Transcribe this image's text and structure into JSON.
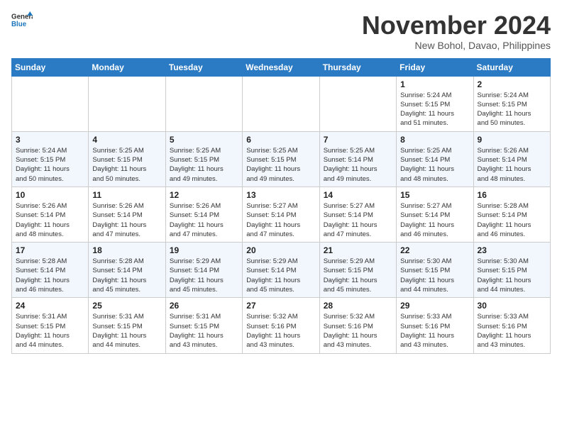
{
  "header": {
    "logo_line1": "General",
    "logo_line2": "Blue",
    "month_year": "November 2024",
    "location": "New Bohol, Davao, Philippines"
  },
  "columns": [
    "Sunday",
    "Monday",
    "Tuesday",
    "Wednesday",
    "Thursday",
    "Friday",
    "Saturday"
  ],
  "weeks": [
    [
      {
        "day": "",
        "info": ""
      },
      {
        "day": "",
        "info": ""
      },
      {
        "day": "",
        "info": ""
      },
      {
        "day": "",
        "info": ""
      },
      {
        "day": "",
        "info": ""
      },
      {
        "day": "1",
        "info": "Sunrise: 5:24 AM\nSunset: 5:15 PM\nDaylight: 11 hours\nand 51 minutes."
      },
      {
        "day": "2",
        "info": "Sunrise: 5:24 AM\nSunset: 5:15 PM\nDaylight: 11 hours\nand 50 minutes."
      }
    ],
    [
      {
        "day": "3",
        "info": "Sunrise: 5:24 AM\nSunset: 5:15 PM\nDaylight: 11 hours\nand 50 minutes."
      },
      {
        "day": "4",
        "info": "Sunrise: 5:25 AM\nSunset: 5:15 PM\nDaylight: 11 hours\nand 50 minutes."
      },
      {
        "day": "5",
        "info": "Sunrise: 5:25 AM\nSunset: 5:15 PM\nDaylight: 11 hours\nand 49 minutes."
      },
      {
        "day": "6",
        "info": "Sunrise: 5:25 AM\nSunset: 5:15 PM\nDaylight: 11 hours\nand 49 minutes."
      },
      {
        "day": "7",
        "info": "Sunrise: 5:25 AM\nSunset: 5:14 PM\nDaylight: 11 hours\nand 49 minutes."
      },
      {
        "day": "8",
        "info": "Sunrise: 5:25 AM\nSunset: 5:14 PM\nDaylight: 11 hours\nand 48 minutes."
      },
      {
        "day": "9",
        "info": "Sunrise: 5:26 AM\nSunset: 5:14 PM\nDaylight: 11 hours\nand 48 minutes."
      }
    ],
    [
      {
        "day": "10",
        "info": "Sunrise: 5:26 AM\nSunset: 5:14 PM\nDaylight: 11 hours\nand 48 minutes."
      },
      {
        "day": "11",
        "info": "Sunrise: 5:26 AM\nSunset: 5:14 PM\nDaylight: 11 hours\nand 47 minutes."
      },
      {
        "day": "12",
        "info": "Sunrise: 5:26 AM\nSunset: 5:14 PM\nDaylight: 11 hours\nand 47 minutes."
      },
      {
        "day": "13",
        "info": "Sunrise: 5:27 AM\nSunset: 5:14 PM\nDaylight: 11 hours\nand 47 minutes."
      },
      {
        "day": "14",
        "info": "Sunrise: 5:27 AM\nSunset: 5:14 PM\nDaylight: 11 hours\nand 47 minutes."
      },
      {
        "day": "15",
        "info": "Sunrise: 5:27 AM\nSunset: 5:14 PM\nDaylight: 11 hours\nand 46 minutes."
      },
      {
        "day": "16",
        "info": "Sunrise: 5:28 AM\nSunset: 5:14 PM\nDaylight: 11 hours\nand 46 minutes."
      }
    ],
    [
      {
        "day": "17",
        "info": "Sunrise: 5:28 AM\nSunset: 5:14 PM\nDaylight: 11 hours\nand 46 minutes."
      },
      {
        "day": "18",
        "info": "Sunrise: 5:28 AM\nSunset: 5:14 PM\nDaylight: 11 hours\nand 45 minutes."
      },
      {
        "day": "19",
        "info": "Sunrise: 5:29 AM\nSunset: 5:14 PM\nDaylight: 11 hours\nand 45 minutes."
      },
      {
        "day": "20",
        "info": "Sunrise: 5:29 AM\nSunset: 5:14 PM\nDaylight: 11 hours\nand 45 minutes."
      },
      {
        "day": "21",
        "info": "Sunrise: 5:29 AM\nSunset: 5:15 PM\nDaylight: 11 hours\nand 45 minutes."
      },
      {
        "day": "22",
        "info": "Sunrise: 5:30 AM\nSunset: 5:15 PM\nDaylight: 11 hours\nand 44 minutes."
      },
      {
        "day": "23",
        "info": "Sunrise: 5:30 AM\nSunset: 5:15 PM\nDaylight: 11 hours\nand 44 minutes."
      }
    ],
    [
      {
        "day": "24",
        "info": "Sunrise: 5:31 AM\nSunset: 5:15 PM\nDaylight: 11 hours\nand 44 minutes."
      },
      {
        "day": "25",
        "info": "Sunrise: 5:31 AM\nSunset: 5:15 PM\nDaylight: 11 hours\nand 44 minutes."
      },
      {
        "day": "26",
        "info": "Sunrise: 5:31 AM\nSunset: 5:15 PM\nDaylight: 11 hours\nand 43 minutes."
      },
      {
        "day": "27",
        "info": "Sunrise: 5:32 AM\nSunset: 5:16 PM\nDaylight: 11 hours\nand 43 minutes."
      },
      {
        "day": "28",
        "info": "Sunrise: 5:32 AM\nSunset: 5:16 PM\nDaylight: 11 hours\nand 43 minutes."
      },
      {
        "day": "29",
        "info": "Sunrise: 5:33 AM\nSunset: 5:16 PM\nDaylight: 11 hours\nand 43 minutes."
      },
      {
        "day": "30",
        "info": "Sunrise: 5:33 AM\nSunset: 5:16 PM\nDaylight: 11 hours\nand 43 minutes."
      }
    ]
  ]
}
